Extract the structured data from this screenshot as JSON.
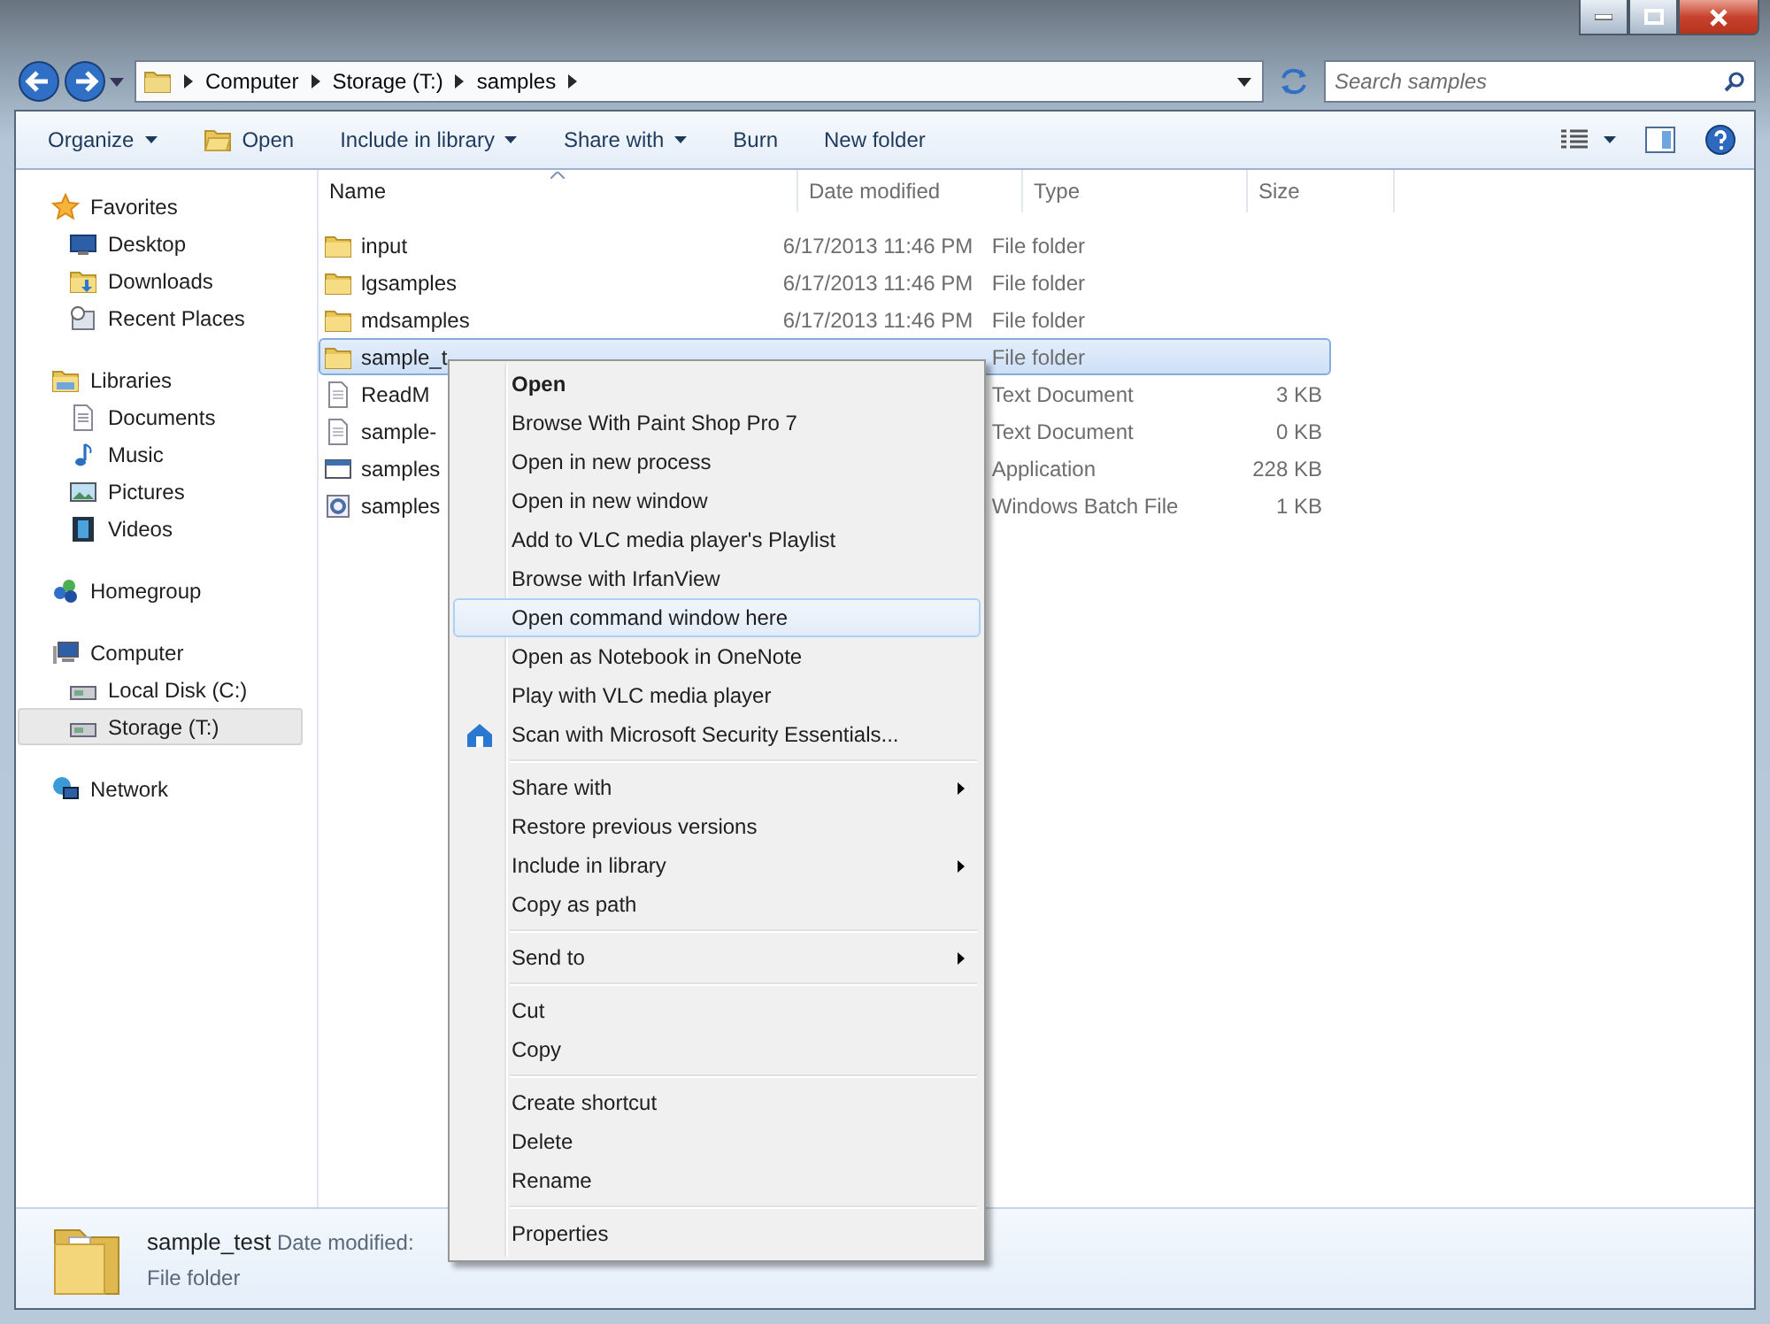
{
  "address": {
    "crumbs": [
      "Computer",
      "Storage (T:)",
      "samples"
    ]
  },
  "search": {
    "placeholder": "Search samples"
  },
  "toolbar": [
    {
      "label": "Organize",
      "dropdown": true,
      "has_icon": false
    },
    {
      "label": "Open",
      "dropdown": false,
      "has_icon": true
    },
    {
      "label": "Include in library",
      "dropdown": true,
      "has_icon": false
    },
    {
      "label": "Share with",
      "dropdown": true,
      "has_icon": false
    },
    {
      "label": "Burn",
      "dropdown": false,
      "has_icon": false
    },
    {
      "label": "New folder",
      "dropdown": false,
      "has_icon": false
    }
  ],
  "sidebar": {
    "groups": [
      {
        "label": "Favorites",
        "kind": "star",
        "selected": false,
        "children": [
          {
            "label": "Desktop",
            "kind": "desktop",
            "selected": false
          },
          {
            "label": "Downloads",
            "kind": "downloads",
            "selected": false
          },
          {
            "label": "Recent Places",
            "kind": "recent",
            "selected": false
          }
        ]
      },
      {
        "label": "Libraries",
        "kind": "libraries",
        "selected": false,
        "children": [
          {
            "label": "Documents",
            "kind": "document",
            "selected": false
          },
          {
            "label": "Music",
            "kind": "music",
            "selected": false
          },
          {
            "label": "Pictures",
            "kind": "pictures",
            "selected": false
          },
          {
            "label": "Videos",
            "kind": "videos",
            "selected": false
          }
        ]
      },
      {
        "label": "Homegroup",
        "kind": "homegroup",
        "selected": false
      },
      {
        "label": "Computer",
        "kind": "computer",
        "selected": false,
        "children": [
          {
            "label": "Local Disk (C:)",
            "kind": "disk",
            "selected": false
          },
          {
            "label": "Storage (T:)",
            "kind": "disk",
            "selected": true
          }
        ]
      },
      {
        "label": "Network",
        "kind": "network",
        "selected": false
      }
    ]
  },
  "columns": [
    {
      "label": "Name",
      "sorted": true
    },
    {
      "label": "Date modified",
      "sorted": false
    },
    {
      "label": "Type",
      "sorted": false
    },
    {
      "label": "Size",
      "sorted": false
    }
  ],
  "rows": [
    {
      "name": "input",
      "date": "6/17/2013 11:46 PM",
      "type": "File folder",
      "kind": "folder",
      "selected": false
    },
    {
      "name": "lgsamples",
      "date": "6/17/2013 11:46 PM",
      "type": "File folder",
      "kind": "folder",
      "selected": false
    },
    {
      "name": "mdsamples",
      "date": "6/17/2013 11:46 PM",
      "type": "File folder",
      "kind": "folder",
      "selected": false
    },
    {
      "name": "sample_t",
      "type": "File folder",
      "kind": "folder",
      "selected": true
    },
    {
      "name": "ReadM",
      "type": "Text Document",
      "size": "3 KB",
      "kind": "text",
      "selected": false
    },
    {
      "name": "sample-",
      "type": "Text Document",
      "size": "0 KB",
      "kind": "text",
      "selected": false
    },
    {
      "name": "samples",
      "type": "Application",
      "size": "228 KB",
      "kind": "app",
      "selected": false
    },
    {
      "name": "samples",
      "type": "Windows Batch File",
      "size": "1 KB",
      "kind": "batch",
      "selected": false
    }
  ],
  "context_menu": {
    "groups": [
      [
        {
          "label": "Open",
          "default": true,
          "has_icon": false,
          "submenu": false,
          "selected": false
        },
        {
          "label": "Browse With Paint Shop Pro 7",
          "default": false,
          "has_icon": false,
          "submenu": false,
          "selected": false
        },
        {
          "label": "Open in new process",
          "default": false,
          "has_icon": false,
          "submenu": false,
          "selected": false
        },
        {
          "label": "Open in new window",
          "default": false,
          "has_icon": false,
          "submenu": false,
          "selected": false
        },
        {
          "label": "Add to VLC media player's Playlist",
          "default": false,
          "has_icon": false,
          "submenu": false,
          "selected": false
        },
        {
          "label": "Browse with IrfanView",
          "default": false,
          "has_icon": false,
          "submenu": false,
          "selected": false
        },
        {
          "label": "Open command window here",
          "default": false,
          "has_icon": false,
          "submenu": false,
          "selected": true
        },
        {
          "label": "Open as Notebook in OneNote",
          "default": false,
          "has_icon": false,
          "submenu": false,
          "selected": false
        },
        {
          "label": "Play with VLC media player",
          "default": false,
          "has_icon": false,
          "submenu": false,
          "selected": false
        },
        {
          "label": "Scan with Microsoft Security Essentials...",
          "default": false,
          "has_icon": true,
          "submenu": false,
          "selected": false
        }
      ],
      [
        {
          "label": "Share with",
          "default": false,
          "has_icon": false,
          "submenu": true,
          "selected": false
        },
        {
          "label": "Restore previous versions",
          "default": false,
          "has_icon": false,
          "submenu": false,
          "selected": false
        },
        {
          "label": "Include in library",
          "default": false,
          "has_icon": false,
          "submenu": true,
          "selected": false
        },
        {
          "label": "Copy as path",
          "default": false,
          "has_icon": false,
          "submenu": false,
          "selected": false
        }
      ],
      [
        {
          "label": "Send to",
          "default": false,
          "has_icon": false,
          "submenu": true,
          "selected": false
        }
      ],
      [
        {
          "label": "Cut",
          "default": false,
          "has_icon": false,
          "submenu": false,
          "selected": false
        },
        {
          "label": "Copy",
          "default": false,
          "has_icon": false,
          "submenu": false,
          "selected": false
        }
      ],
      [
        {
          "label": "Create shortcut",
          "default": false,
          "has_icon": false,
          "submenu": false,
          "selected": false
        },
        {
          "label": "Delete",
          "default": false,
          "has_icon": false,
          "submenu": false,
          "selected": false
        },
        {
          "label": "Rename",
          "default": false,
          "has_icon": false,
          "submenu": false,
          "selected": false
        }
      ],
      [
        {
          "label": "Properties",
          "default": false,
          "has_icon": false,
          "submenu": false,
          "selected": false
        }
      ]
    ]
  },
  "details": {
    "name": "sample_test",
    "date_label": "Date modified:",
    "type": "File folder"
  }
}
